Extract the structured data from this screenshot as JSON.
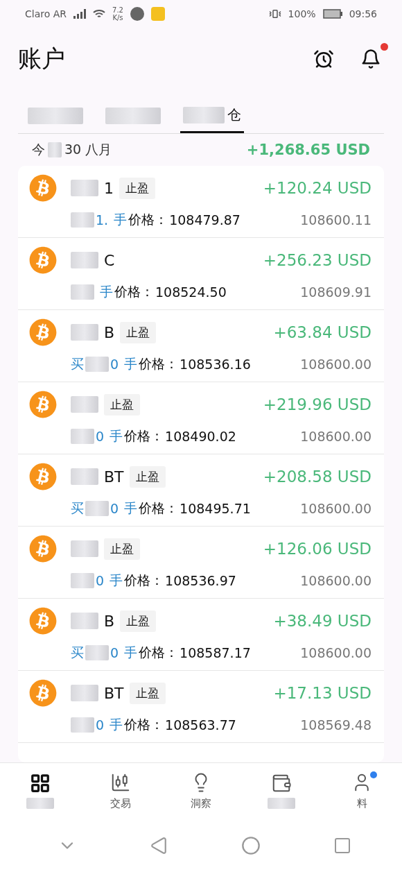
{
  "status_bar": {
    "carrier": "Claro AR",
    "speed": "7.2",
    "speed_unit": "K/s",
    "battery": "100%",
    "time": "09:56"
  },
  "header": {
    "title": "账户",
    "notification_badge": true
  },
  "tabs": [
    {
      "selected": false
    },
    {
      "selected": false
    },
    {
      "label": "仓",
      "selected": true
    }
  ],
  "summary": {
    "date_prefix": "今",
    "date": "30 八月",
    "total": "+1,268.65 USD"
  },
  "positions": [
    {
      "name": "1",
      "tag": "止盈",
      "profit": "+120.24 USD",
      "lot": "1.",
      "unit": "手",
      "price_label": "价格：",
      "open_price": "108479.87",
      "current_price": "108600.11"
    },
    {
      "name": "C",
      "profit": "+256.23 USD",
      "unit": "手",
      "price_label": "价格：",
      "open_price": "108524.50",
      "current_price": "108609.91"
    },
    {
      "name": "B",
      "tag": "止盈",
      "profit": "+63.84 USD",
      "side": "买",
      "lot": "0",
      "unit": "手",
      "price_label": "价格：",
      "open_price": "108536.16",
      "current_price": "108600.00"
    },
    {
      "tag": "止盈",
      "profit": "+219.96 USD",
      "lot": "0",
      "unit": "手",
      "price_label": "价格：",
      "open_price": "108490.02",
      "current_price": "108600.00"
    },
    {
      "name": "BT",
      "tag": "止盈",
      "profit": "+208.58 USD",
      "side": "买",
      "lot": "0",
      "unit": "手",
      "price_label": "价格：",
      "open_price": "108495.71",
      "current_price": "108600.00"
    },
    {
      "tag": "止盈",
      "profit": "+126.06 USD",
      "lot": "0",
      "unit": "手",
      "price_label": "价格：",
      "open_price": "108536.97",
      "current_price": "108600.00"
    },
    {
      "name": "B",
      "tag": "止盈",
      "profit": "+38.49 USD",
      "side": "买",
      "lot": "0",
      "unit": "手",
      "price_label": "价格：",
      "open_price": "108587.17",
      "current_price": "108600.00"
    },
    {
      "name": "BT",
      "tag": "止盈",
      "profit": "+17.13 USD",
      "lot": "0",
      "unit": "手",
      "price_label": "价格：",
      "open_price": "108563.77",
      "current_price": "108569.48"
    }
  ],
  "bottom_nav": [
    {
      "selected": true,
      "badge": false
    },
    {
      "label": "交易",
      "selected": false,
      "badge": false
    },
    {
      "label": "洞察",
      "selected": false,
      "badge": false
    },
    {
      "selected": false,
      "badge": false
    },
    {
      "label": "料",
      "selected": false,
      "badge": true
    }
  ]
}
